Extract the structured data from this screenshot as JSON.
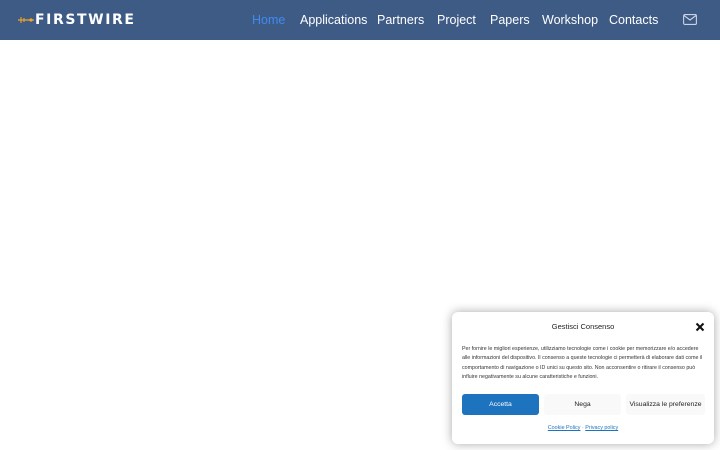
{
  "header": {
    "logo_text": "FIRSTWIRE",
    "bg_color": "#3e5b86",
    "active_color": "#3d8bf2",
    "nav": [
      {
        "label": "Home",
        "active": true
      },
      {
        "label": "Applications",
        "active": false
      },
      {
        "label": "Partners",
        "active": false
      },
      {
        "label": "Project",
        "active": false
      },
      {
        "label": "Papers",
        "active": false
      },
      {
        "label": "Workshop",
        "active": false
      },
      {
        "label": "Contacts",
        "active": false
      }
    ],
    "contact_icon": "envelope-icon"
  },
  "consent": {
    "title": "Gestisci Consenso",
    "body": "Per fornire le migliori esperienze, utilizziamo tecnologie come i cookie per memorizzare e/o accedere alle informazioni del dispositivo. Il consenso a queste tecnologie ci permetterà di elaborare dati come il comportamento di navigazione o ID unici su questo sito. Non acconsentire o ritirare il consenso può influire negativamente su alcune caratteristiche e funzioni.",
    "accept_label": "Accetta",
    "deny_label": "Nega",
    "preferences_label": "Visualizza le preferenze",
    "cookie_policy_label": "Cookie Policy",
    "separator": "·",
    "privacy_policy_label": "Privacy policy",
    "accent_color": "#1e73be",
    "close_icon": "close-icon"
  }
}
